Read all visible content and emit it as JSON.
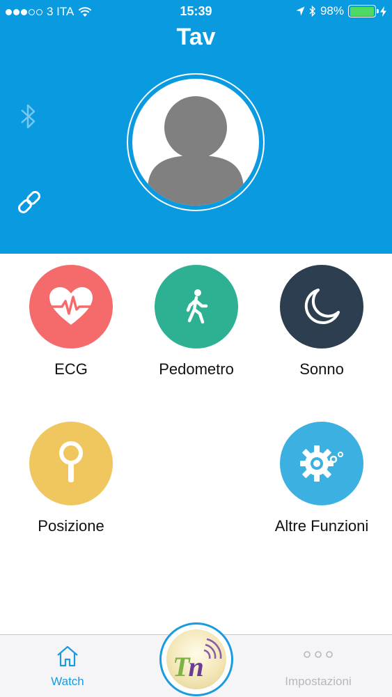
{
  "status_bar": {
    "carrier": "3 ITA",
    "time": "15:39",
    "battery_percent": "98%",
    "battery_level": 0.98,
    "signal_strength": "3 of 5",
    "colors": {
      "battery_fill": "#4cd964"
    }
  },
  "header": {
    "title": "Tav",
    "background_color": "#0a9ae0",
    "bluetooth_icon": "bluetooth-icon",
    "link_icon": "link-icon",
    "avatar_icon": "person-silhouette-icon"
  },
  "features": [
    {
      "label": "ECG",
      "icon": "heart-ecg-icon",
      "color": "#f56a6a"
    },
    {
      "label": "Pedometro",
      "icon": "walking-person-icon",
      "color": "#2db192"
    },
    {
      "label": "Sonno",
      "icon": "moon-icon",
      "color": "#2c3e4f"
    },
    {
      "label": "Posizione",
      "icon": "location-pin-icon",
      "color": "#f0c75e"
    },
    {
      "label": "Altre Funzioni",
      "icon": "gear-icon",
      "color": "#3cb0e0"
    }
  ],
  "tabbar": {
    "watch_label": "Watch",
    "settings_label": "Impostazioni",
    "center_logo_text": "Tn",
    "active_color": "#1a9be0",
    "inactive_color": "#b8b8bc"
  }
}
